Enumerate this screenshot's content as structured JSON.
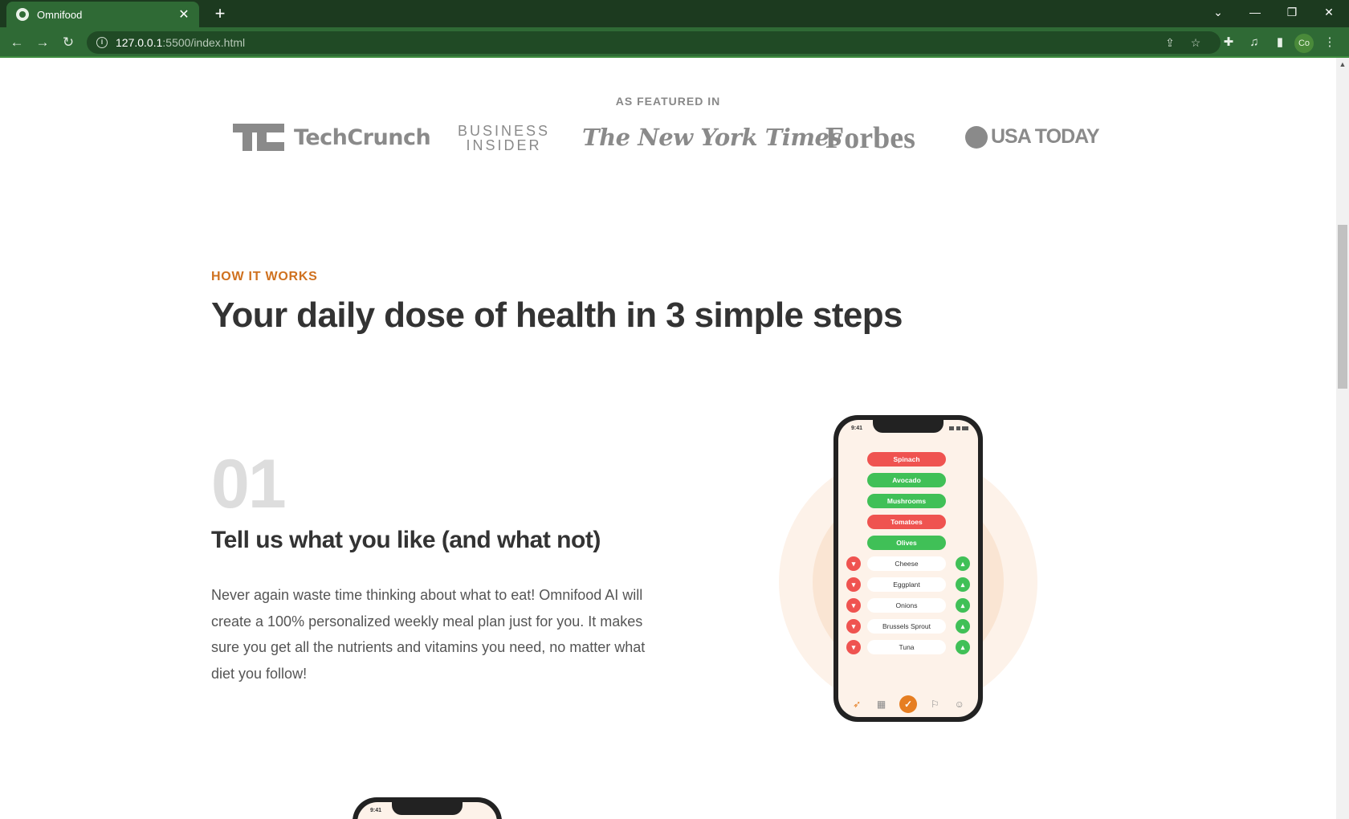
{
  "browser": {
    "tab_title": "Omnifood",
    "url_host": "127.0.0.1",
    "url_path": ":5500/index.html",
    "profile_initials": "Co"
  },
  "featured": {
    "heading": "AS FEATURED IN",
    "logos": [
      "TechCrunch",
      "BUSINESS",
      "INSIDER",
      "The New York Times",
      "Forbes",
      "USA TODAY"
    ]
  },
  "how": {
    "subheading": "HOW IT WORKS",
    "title": "Your daily dose of health in 3 simple steps"
  },
  "step1": {
    "number": "01",
    "title": "Tell us what you like (and what not)",
    "description": "Never again waste time thinking about what to eat! Omnifood AI will create a 100% personalized weekly meal plan just for you. It makes sure you get all the nutrients and vitamins you need, no matter what diet you follow!"
  },
  "phone": {
    "time": "9:41",
    "disliked_color": "#ef5350",
    "liked_color": "#40c057",
    "accent": "#e67e22",
    "chosen_foods": [
      {
        "name": "Spinach",
        "status": "disliked"
      },
      {
        "name": "Avocado",
        "status": "liked"
      },
      {
        "name": "Mushrooms",
        "status": "liked"
      },
      {
        "name": "Tomatoes",
        "status": "disliked"
      },
      {
        "name": "Olives",
        "status": "liked"
      }
    ],
    "unrated_foods": [
      "Cheese",
      "Eggplant",
      "Onions",
      "Brussels Sprout",
      "Tuna"
    ],
    "nav_icons": [
      "carrot-icon",
      "calendar-icon",
      "check-icon",
      "bookmark-icon",
      "user-icon"
    ]
  },
  "phone2": {
    "time": "9:41"
  },
  "colors": {
    "brand": "#e67e22",
    "subheading": "#cf711f",
    "chrome": "#2f6a35"
  }
}
